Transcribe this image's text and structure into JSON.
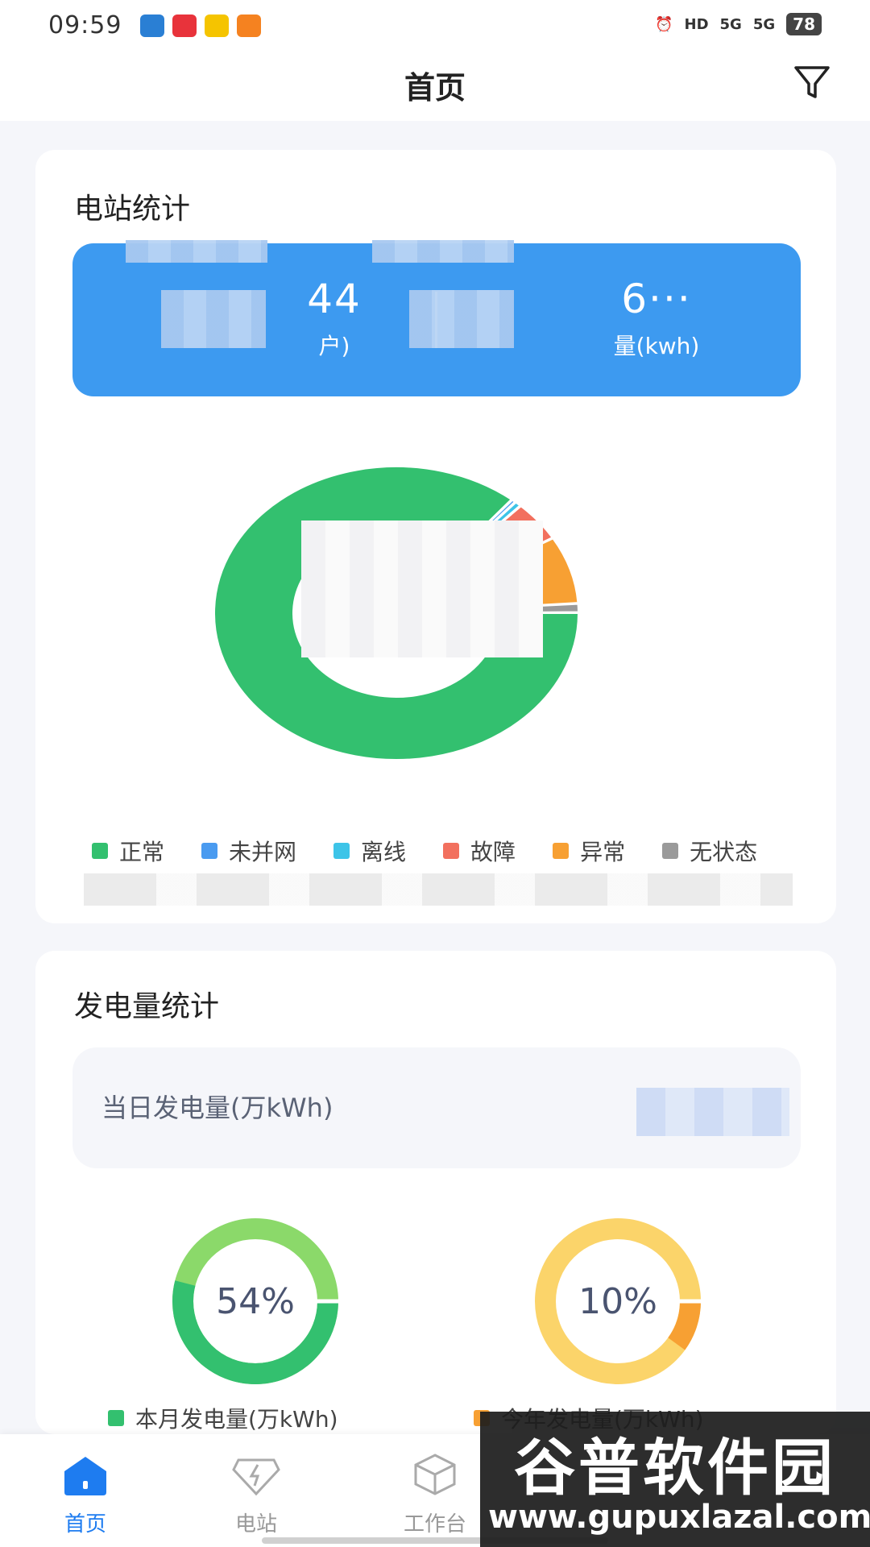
{
  "status_bar": {
    "time": "09:59",
    "hd_label": "HD",
    "signal_1": "5G",
    "signal_2": "5G",
    "battery": "78"
  },
  "header": {
    "title": "首页"
  },
  "station_stats": {
    "title": "电站统计",
    "summary": {
      "left_value": "44",
      "left_label": "户)",
      "right_value": "6···",
      "right_label": "量(kwh)"
    },
    "donut": {
      "segments": [
        {
          "name": "正常",
          "fraction": 0.86,
          "color": "#33c06f"
        },
        {
          "name": "未并网",
          "fraction": 0.004,
          "color": "#4a9bf0"
        },
        {
          "name": "离线",
          "fraction": 0.006,
          "color": "#3dc4e8"
        },
        {
          "name": "故障",
          "fraction": 0.045,
          "color": "#f2705e"
        },
        {
          "name": "异常",
          "fraction": 0.075,
          "color": "#f7a033"
        },
        {
          "name": "无状态",
          "fraction": 0.01,
          "color": "#9a9a9a"
        }
      ]
    },
    "legend": [
      {
        "label": "正常",
        "color": "#33c06f"
      },
      {
        "label": "未并网",
        "color": "#4a9bf0"
      },
      {
        "label": "离线",
        "color": "#3dc4e8"
      },
      {
        "label": "故障",
        "color": "#f2705e"
      },
      {
        "label": "异常",
        "color": "#f7a033"
      },
      {
        "label": "无状态",
        "color": "#9a9a9a"
      }
    ]
  },
  "power_stats": {
    "title": "发电量统计",
    "day_label": "当日发电量(万kWh)",
    "month": {
      "percent_text": "54%",
      "fraction": 0.54,
      "label": "本月发电量(万kWh)",
      "color": "#33c06f",
      "track": "#8bd96a"
    },
    "year": {
      "percent_text": "10%",
      "fraction": 0.1,
      "label": "今年发电量(万kWh)",
      "color": "#f7a033",
      "track": "#fbd46a"
    }
  },
  "tabbar": [
    {
      "label": "首页",
      "active": true
    },
    {
      "label": "电站",
      "active": false
    },
    {
      "label": "工作台",
      "active": false
    }
  ],
  "watermark": {
    "line1": "谷普软件园",
    "line2": "www.gupuxlazal.com"
  }
}
